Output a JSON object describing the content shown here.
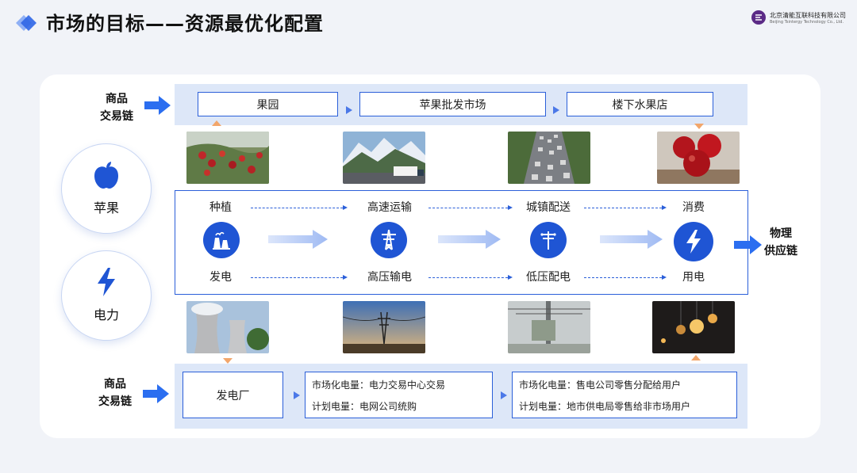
{
  "header": {
    "title": "市场的目标——资源最优化配置",
    "brand_cn": "北京清能互联科技有限公司",
    "brand_en": "Beijing Tsintergy Technology Co., Ltd."
  },
  "colors": {
    "accent": "#1f55d4",
    "band": "#dde7f8",
    "arrow": "#2b6ef0",
    "marker": "#f2a66b"
  },
  "top_chain": {
    "label_line1": "商品",
    "label_line2": "交易链",
    "boxes": [
      "果园",
      "苹果批发市场",
      "楼下水果店"
    ]
  },
  "left_circles": [
    {
      "label": "苹果",
      "icon": "apple-icon"
    },
    {
      "label": "电力",
      "icon": "lightning-icon"
    }
  ],
  "flow": {
    "apple_steps": [
      "种植",
      "高速运输",
      "城镇配送",
      "消费"
    ],
    "power_steps": [
      "发电",
      "高压输电",
      "低压配电",
      "用电"
    ],
    "icons": [
      "power-plant-icon",
      "transmission-tower-icon",
      "distribution-pole-icon",
      "lightning-icon"
    ]
  },
  "right_label": {
    "line1": "物理",
    "line2": "供应链"
  },
  "photos_top": [
    "apple-orchard",
    "highway-truck",
    "traffic-road",
    "red-apples"
  ],
  "photos_bottom": [
    "cooling-towers",
    "power-lines",
    "transformer",
    "light-bulbs"
  ],
  "bottom_chain": {
    "label_line1": "商品",
    "label_line2": "交易链",
    "box1": "发电厂",
    "box2_line1": "市场化电量：电力交易中心交易",
    "box2_line2": "计划电量：电网公司统购",
    "box3_line1": "市场化电量：售电公司零售分配给用户",
    "box3_line2": "计划电量：地市供电局零售给非市场用户"
  }
}
